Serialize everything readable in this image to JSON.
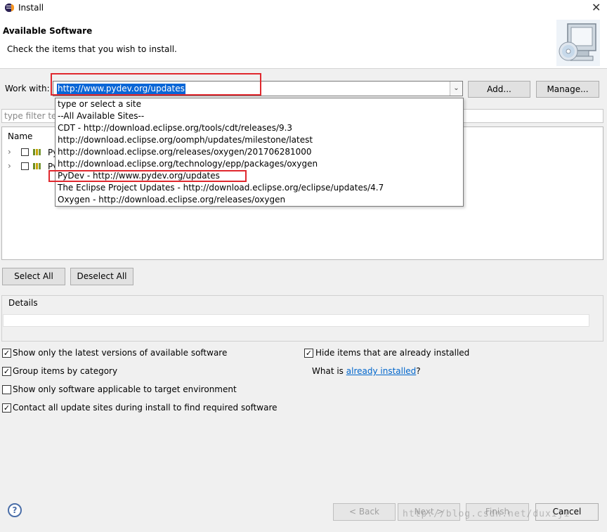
{
  "window": {
    "title": "Install",
    "close_glyph": "✕"
  },
  "header": {
    "title": "Available Software",
    "subtitle": "Check the items that you wish to install."
  },
  "work_with": {
    "label": "Work with:",
    "value": "http://www.pydev.org/updates",
    "add_label": "Add...",
    "manage_label": "Manage..."
  },
  "dropdown": {
    "items": [
      "type or select a site",
      "--All Available Sites--",
      "CDT - http://download.eclipse.org/tools/cdt/releases/9.3",
      "http://download.eclipse.org/oomph/updates/milestone/latest",
      "http://download.eclipse.org/releases/oxygen/201706281000",
      "http://download.eclipse.org/technology/epp/packages/oxygen",
      "PyDev - http://www.pydev.org/updates",
      "The Eclipse Project Updates - http://download.eclipse.org/eclipse/updates/4.7",
      "Oxygen - http://download.eclipse.org/releases/oxygen"
    ]
  },
  "filter": {
    "placeholder": "type filter tex"
  },
  "tree": {
    "header": "Name",
    "rows": [
      {
        "label": "Py"
      },
      {
        "label": "Py"
      }
    ],
    "expander_glyph": "›"
  },
  "buttons": {
    "select_all": "Select All",
    "deselect_all": "Deselect All"
  },
  "details": {
    "label": "Details"
  },
  "options": {
    "latest_versions": {
      "label": "Show only the latest versions of available software",
      "checked": true
    },
    "group_by_category": {
      "label": "Group items by category",
      "checked": true
    },
    "target_env": {
      "label": "Show only software applicable to target environment",
      "checked": false
    },
    "contact_sites": {
      "label": "Contact all update sites during install to find required software",
      "checked": true
    },
    "hide_installed": {
      "label": "Hide items that are already installed",
      "checked": true
    },
    "what_is_prefix": "What is ",
    "already_installed_link": "already installed",
    "what_is_suffix": "?"
  },
  "footer": {
    "help_glyph": "?",
    "back": "< Back",
    "next": "Next >",
    "finish": "Finish",
    "cancel": "Cancel",
    "watermark": "http://blog.csdn.net/duxiji"
  },
  "colors": {
    "highlight": "#e0282e",
    "selection": "#0a66d6",
    "link": "#0066cc"
  }
}
